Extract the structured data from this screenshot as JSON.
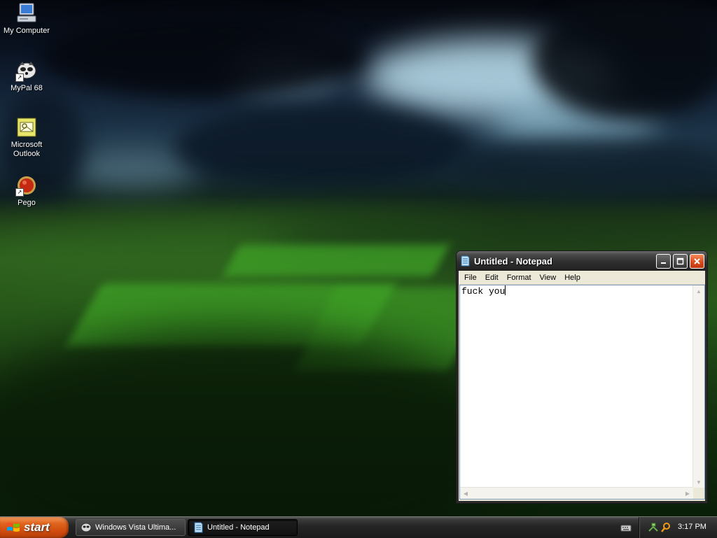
{
  "desktop": {
    "icons": [
      {
        "label": "My Computer",
        "icon": "my-computer-icon"
      },
      {
        "label": "MyPal 68",
        "icon": "mypal-browser-icon",
        "shortcut": true
      },
      {
        "label": "Microsoft Outlook",
        "icon": "outlook-icon"
      },
      {
        "label": "Pego",
        "icon": "pego-icon",
        "shortcut": true
      }
    ]
  },
  "notepad": {
    "title": "Untitled - Notepad",
    "menu": [
      "File",
      "Edit",
      "Format",
      "View",
      "Help"
    ],
    "content": "fuck you"
  },
  "taskbar": {
    "start_label": "start",
    "tasks": [
      {
        "label": "Windows Vista Ultima...",
        "active": false
      },
      {
        "label": "Untitled - Notepad",
        "active": true
      }
    ],
    "clock": "3:17 PM"
  },
  "colors": {
    "start_button": "#d9571a",
    "titlebar": "#2e2e2e",
    "close_button": "#d6481c",
    "taskbar": "#262626"
  }
}
